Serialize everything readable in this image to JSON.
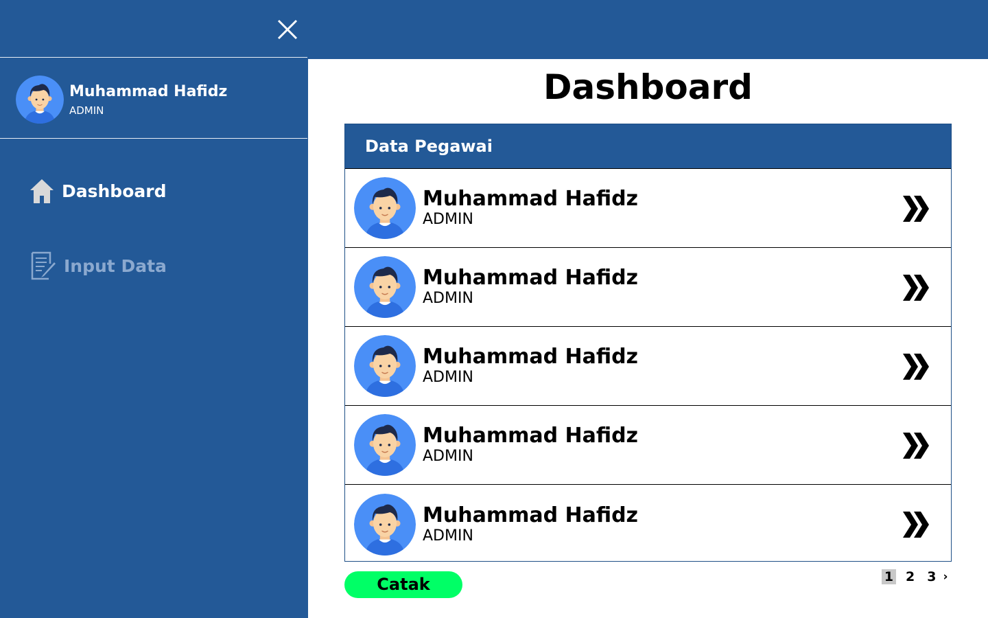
{
  "sidebar": {
    "profile": {
      "name": "Muhammad Hafidz",
      "role": "ADMIN"
    },
    "nav": [
      {
        "label": "Dashboard",
        "icon": "home-icon",
        "active": true
      },
      {
        "label": "Input Data",
        "icon": "document-edit-icon",
        "active": false
      }
    ]
  },
  "main": {
    "title": "Dashboard",
    "panel": {
      "header": "Data Pegawai",
      "rows": [
        {
          "name": "Muhammad Hafidz",
          "role": "ADMIN"
        },
        {
          "name": "Muhammad Hafidz",
          "role": "ADMIN"
        },
        {
          "name": "Muhammad Hafidz",
          "role": "ADMIN"
        },
        {
          "name": "Muhammad Hafidz",
          "role": "ADMIN"
        },
        {
          "name": "Muhammad Hafidz",
          "role": "ADMIN"
        }
      ]
    },
    "print_label": "Catak",
    "pagination": {
      "pages": [
        "1",
        "2",
        "3"
      ],
      "current": "1",
      "next": "›"
    }
  },
  "colors": {
    "primary": "#235997",
    "accent_button": "#00ff66",
    "avatar_bg": "#4a8ff7",
    "inactive_nav": "#8ba9cf"
  }
}
